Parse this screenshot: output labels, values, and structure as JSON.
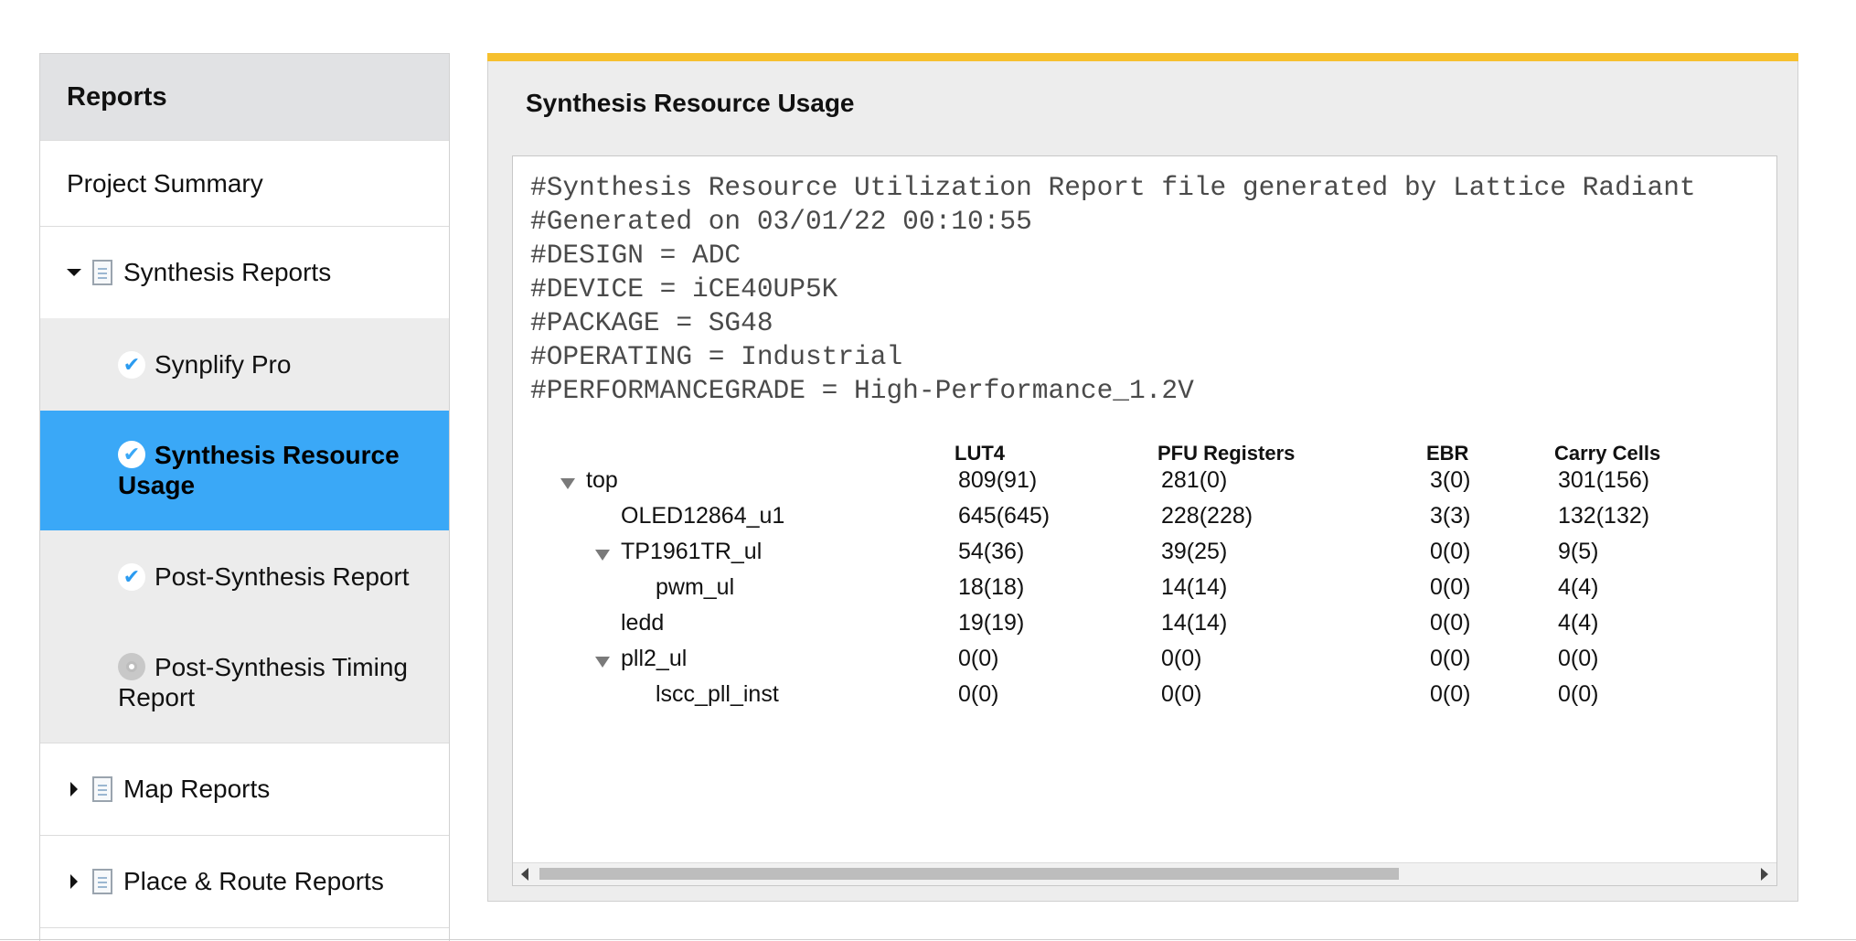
{
  "sidebar": {
    "heading": "Reports",
    "project_summary": "Project Summary",
    "synthesis_group": "Synthesis Reports",
    "synplify": "Synplify Pro",
    "resource_usage": "Synthesis Resource Usage",
    "post_synthesis": "Post-Synthesis Report",
    "post_synthesis_timing": "Post-Synthesis Timing Report",
    "map_reports": "Map Reports",
    "par_reports": "Place & Route Reports"
  },
  "panel": {
    "title": "Synthesis Resource Usage",
    "accent_color": "#f6c02e",
    "report_lines": "#Synthesis Resource Utilization Report file generated by Lattice Radiant\n#Generated on 03/01/22 00:10:55\n#DESIGN = ADC\n#DEVICE = iCE40UP5K\n#PACKAGE = SG48\n#OPERATING = Industrial\n#PERFORMANCEGRADE = High-Performance_1.2V"
  },
  "table": {
    "headers": [
      "LUT4",
      "PFU Registers",
      "EBR",
      "Carry Cells"
    ],
    "rows": [
      {
        "name": "top",
        "lut4": "809(91)",
        "pfu": "281(0)",
        "ebr": "3(0)",
        "carry": "301(156)"
      },
      {
        "name": "OLED12864_u1",
        "lut4": "645(645)",
        "pfu": "228(228)",
        "ebr": "3(3)",
        "carry": "132(132)"
      },
      {
        "name": "TP1961TR_ul",
        "lut4": "54(36)",
        "pfu": "39(25)",
        "ebr": "0(0)",
        "carry": "9(5)"
      },
      {
        "name": "pwm_ul",
        "lut4": "18(18)",
        "pfu": "14(14)",
        "ebr": "0(0)",
        "carry": "4(4)"
      },
      {
        "name": "ledd",
        "lut4": "19(19)",
        "pfu": "14(14)",
        "ebr": "0(0)",
        "carry": "4(4)"
      },
      {
        "name": "pll2_ul",
        "lut4": "0(0)",
        "pfu": "0(0)",
        "ebr": "0(0)",
        "carry": "0(0)"
      },
      {
        "name": "lscc_pll_inst",
        "lut4": "0(0)",
        "pfu": "0(0)",
        "ebr": "0(0)",
        "carry": "0(0)"
      }
    ]
  },
  "colors": {
    "active_item": "#3aa8f7",
    "header_bg": "#e1e2e4"
  }
}
